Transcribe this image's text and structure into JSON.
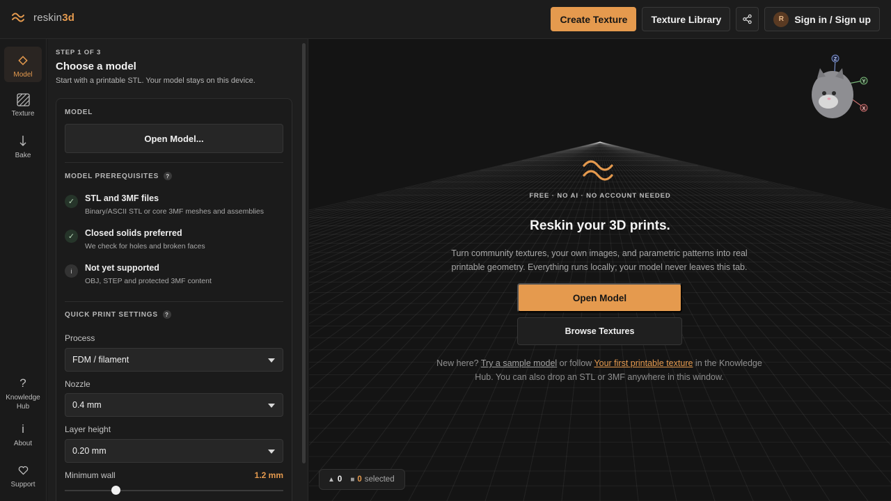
{
  "app": {
    "brand_name": "reskin",
    "brand_accent": "3d",
    "accent_color": "#e59a4e"
  },
  "header": {
    "create_texture_label": "Create Texture",
    "texture_library_label": "Texture Library",
    "avatar_initial": "R",
    "sign_in_label": "Sign in / Sign up"
  },
  "rail": {
    "items": [
      {
        "label": "Model",
        "icon": "diamond-icon",
        "active": true
      },
      {
        "label": "Texture",
        "icon": "hatch-icon",
        "active": false
      },
      {
        "label": "Bake",
        "icon": "arrow-down-icon",
        "active": false
      }
    ],
    "bottom": [
      {
        "label": "Knowledge Hub",
        "icon": "question-icon"
      },
      {
        "label": "About",
        "icon": "info-icon"
      },
      {
        "label": "Support",
        "icon": "heart-icon"
      }
    ]
  },
  "panel": {
    "step_label": "STEP 1 OF 3",
    "title": "Choose a model",
    "subtitle": "Start with a printable STL. Your model stays on this device.",
    "model_section_label": "MODEL",
    "open_model_label": "Open Model...",
    "prereq_label": "MODEL PREREQUISITES",
    "prereqs": [
      {
        "title": "STL and 3MF files",
        "desc": "Binary/ASCII STL or core 3MF meshes and assemblies",
        "status": "ok"
      },
      {
        "title": "Closed solids preferred",
        "desc": "We check for holes and broken faces",
        "status": "ok"
      },
      {
        "title": "Not yet supported",
        "desc": "OBJ, STEP and protected 3MF content",
        "status": "info"
      }
    ],
    "quick_print_label": "QUICK PRINT SETTINGS",
    "process_label": "Process",
    "process_value": "FDM / filament",
    "nozzle_label": "Nozzle",
    "nozzle_value": "0.4 mm",
    "layer_label": "Layer height",
    "layer_value": "0.20 mm",
    "wall_label": "Minimum wall",
    "wall_value": "1.2 mm"
  },
  "viewport": {
    "badge": "FREE · NO AI · NO ACCOUNT NEEDED",
    "title": "Reskin your 3D prints.",
    "description": "Turn community textures, your own images, and parametric patterns into real printable geometry. Everything runs locally; your model never leaves this tab.",
    "open_model_label": "Open Model",
    "browse_label": "Browse Textures",
    "help_prefix": "New here?",
    "help_sample_link": "Try a sample model",
    "help_mid": "or follow",
    "help_guide_link": "Your first printable texture",
    "help_suffix": "in the Knowledge Hub. You can also drop an STL or 3MF anywhere in this window.",
    "triangle_count": "0",
    "selected_count": "0",
    "selected_label": "selected",
    "gizmo_axes": [
      "Z",
      "Y",
      "X"
    ]
  }
}
